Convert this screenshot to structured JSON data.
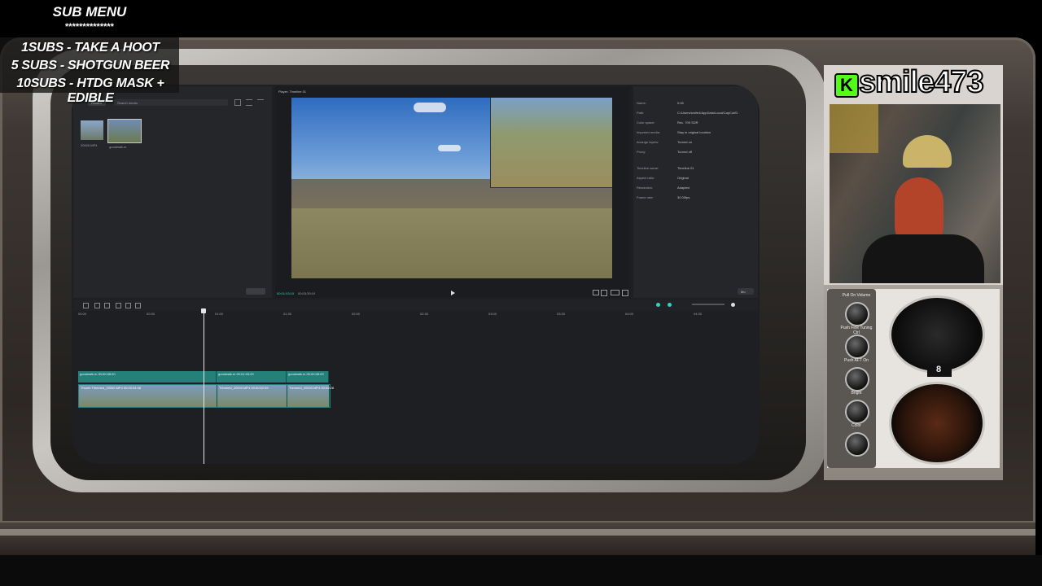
{
  "sub_menu": {
    "title": "SUB MENU",
    "stars": "**************",
    "items": [
      "1SUBS   - TAKE A HOOT",
      "5 SUBS  - SHOTGUN BEER",
      "10SUBS - HTDG MASK + EDIBLE"
    ]
  },
  "channel": {
    "name": "smile473",
    "logo_letter": "K",
    "brand_color": "#53fc18"
  },
  "editor": {
    "media_panel": {
      "tabs": [
        "Record",
        "Search media"
      ],
      "thumbnails": [
        "20000.MP4",
        "goodwalk.m"
      ]
    },
    "player": {
      "title": "Player: Timeline 01",
      "time_current": "00:01:03:19",
      "time_total": "00:03:39:19"
    },
    "details": {
      "rows": [
        {
          "label": "Name:",
          "value": "0:45"
        },
        {
          "label": "Path:",
          "value": "C:/Users/smile4/AppData/Local/CapCut/D"
        },
        {
          "label": "Color space:",
          "value": "Rec. 709 SDR"
        },
        {
          "label": "Imported media:",
          "value": "Stay in original location"
        },
        {
          "label": "Arrange layers:",
          "value": "Turned on"
        },
        {
          "label": "Proxy:",
          "value": "Turned off"
        },
        {
          "label": "Timeline name:",
          "value": "Timeline 01"
        },
        {
          "label": "Aspect ratio:",
          "value": "Original"
        },
        {
          "label": "Resolution:",
          "value": "Adapted"
        },
        {
          "label": "Frame rate:",
          "value": "30.00fps"
        }
      ],
      "modify_label": "Mo"
    },
    "timeline": {
      "ruler": [
        "00:00",
        "00:30",
        "01:00",
        "01:30",
        "02:00",
        "02:30",
        "03:00",
        "03:30",
        "04:00",
        "04:30"
      ],
      "clips_top": [
        {
          "label": "goodwalk.m  00:00:08:20"
        },
        {
          "label": "goodwalk.m  00:01:03:29"
        },
        {
          "label": "goodwalk.m  00:00:08:29"
        }
      ],
      "clips_bottom": [
        {
          "label": "Thumb  Trimmed_20000.MP4  00:00:04:08"
        },
        {
          "label": "Trimmed_20000.MP4  00:00:52:09"
        },
        {
          "label": "Trimmed_20000.MP4  00:00:28"
        }
      ]
    }
  },
  "tv_controls": {
    "labels": [
      "Pull On Volume",
      "Push Fine Tuning Ctrl",
      "Push AFT On",
      "Bright",
      "Color"
    ],
    "dial_number": "8"
  }
}
